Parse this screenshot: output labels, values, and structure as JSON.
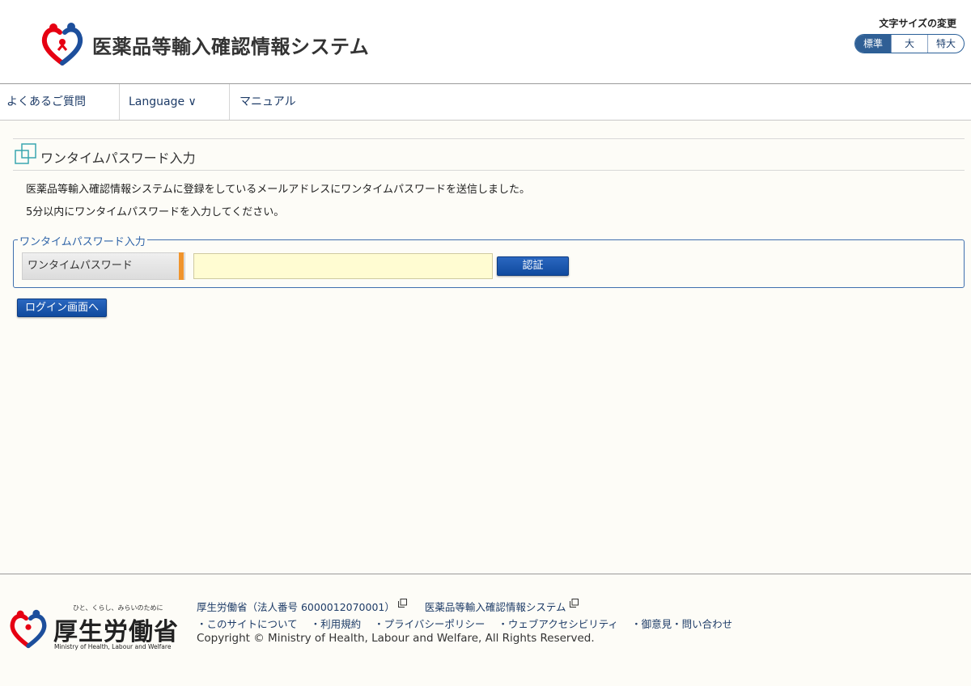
{
  "header": {
    "title": "医薬品等輸入確認情報システム",
    "fontsize_label": "文字サイズの変更",
    "fontsize_options": [
      "標準",
      "大",
      "特大"
    ],
    "fontsize_selected": "標準"
  },
  "nav": {
    "items": [
      {
        "label": "よくあるご質問"
      },
      {
        "label": "Language ∨"
      },
      {
        "label": "マニュアル"
      }
    ]
  },
  "main": {
    "heading": "ワンタイムパスワード入力",
    "message1": "医薬品等輸入確認情報システムに登録をしているメールアドレスにワンタイムパスワードを送信しました。",
    "message2": "5分以内にワンタイムパスワードを入力してください。",
    "fieldset_legend": "ワンタイムパスワード入力",
    "field_label": "ワンタイムパスワード",
    "otp_value": "",
    "auth_button": "認証",
    "login_button": "ログイン画面へ"
  },
  "footer": {
    "tagline": "ひと、くらし、みらいのために",
    "org_name": "厚生労働省",
    "org_name_en": "Ministry of Health, Labour and Welfare",
    "link_mhlw": "厚生労働省（法人番号 6000012070001）",
    "link_system": "医薬品等輸入確認情報システム",
    "links": [
      "・このサイトについて",
      "・利用規約",
      "・プライバシーポリシー",
      "・ウェブアクセシビリティ",
      "・御意見・問い合わせ"
    ],
    "copyright": "Copyright © Ministry of Health, Labour and Welfare, All Rights Reserved."
  },
  "colors": {
    "brand_blue": "#104a9e",
    "logo_red": "#e60012",
    "logo_blue": "#1d4f9c",
    "required_orange": "#f0942c",
    "input_bg": "#fffcd2"
  }
}
